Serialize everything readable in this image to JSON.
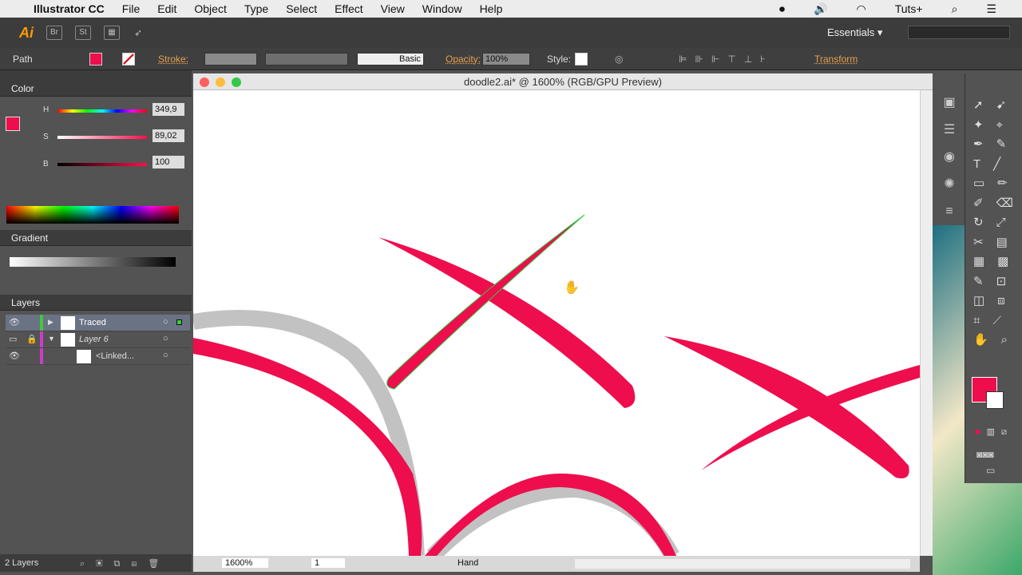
{
  "menubar": {
    "app": "Illustrator CC",
    "items": [
      "File",
      "Edit",
      "Object",
      "Type",
      "Select",
      "Effect",
      "View",
      "Window",
      "Help"
    ],
    "right": "Tuts+"
  },
  "appbar": {
    "logo": "Ai",
    "br": "Br",
    "st": "St",
    "workspace": "Essentials"
  },
  "control": {
    "selection": "Path",
    "stroke_label": "Stroke:",
    "brush": "Basic",
    "opacity_label": "Opacity:",
    "opacity": "100%",
    "style_label": "Style:",
    "transform": "Transform",
    "fill_color": "#ee0e4d"
  },
  "color_panel": {
    "title": "Color",
    "h_label": "H",
    "h": "349,9",
    "s_label": "S",
    "s": "89,02",
    "b_label": "B",
    "b": "100",
    "pct": "%",
    "h_frac": 0.97,
    "s_frac": 0.89,
    "b_frac": 1.0
  },
  "gradient_panel": {
    "title": "Gradient"
  },
  "layers_panel": {
    "title": "Layers",
    "rows": [
      {
        "name": "Traced",
        "color": "#3ec93e"
      },
      {
        "name": "Layer 6",
        "color": "#c83ec8"
      },
      {
        "name": "<Linked...",
        "color": "#c83ec8"
      }
    ],
    "count": "2 Layers"
  },
  "document": {
    "title": "doodle2.ai* @ 1600% (RGB/GPU Preview)",
    "stroke_color": "#ee0e4d"
  },
  "status": {
    "zoom": "1600%",
    "artboard": "1",
    "tool": "Hand"
  }
}
